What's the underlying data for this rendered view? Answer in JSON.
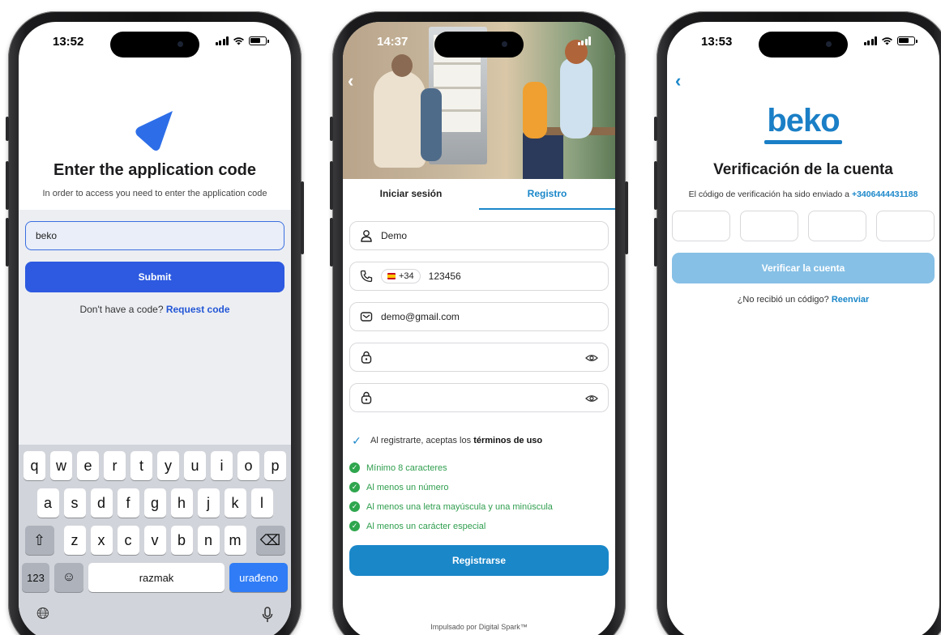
{
  "phone1": {
    "time": "13:52",
    "title": "Enter the application code",
    "subtitle": "In order to access you need to enter the application code",
    "input_value": "beko",
    "submit_label": "Submit",
    "footer_prefix": "Don't have a code?",
    "footer_link": "Request code",
    "keyboard": {
      "row1": [
        "q",
        "w",
        "e",
        "r",
        "t",
        "y",
        "u",
        "i",
        "o",
        "p"
      ],
      "row2": [
        "a",
        "s",
        "d",
        "f",
        "g",
        "h",
        "j",
        "k",
        "l"
      ],
      "row3": [
        "z",
        "x",
        "c",
        "v",
        "b",
        "n",
        "m"
      ],
      "num_key": "123",
      "space_label": "razmak",
      "return_label": "urađeno"
    }
  },
  "phone2": {
    "time": "14:37",
    "tabs": [
      "Iniciar sesión",
      "Registro"
    ],
    "active_tab": "Registro",
    "name_value": "Demo",
    "phone_prefix": "+34",
    "phone_value": "123456",
    "email_value": "demo@gmail.com",
    "terms_prefix": "Al registrarte, aceptas los",
    "terms_link": "términos de uso",
    "rules": [
      "Mínimo 8 caracteres",
      "Al menos un número",
      "Al menos una letra mayúscula y una minúscula",
      "Al menos un carácter especial"
    ],
    "register_label": "Registrarse",
    "powered_by": "Impulsado por Digital Spark™"
  },
  "phone3": {
    "time": "13:53",
    "logo_text": "beko",
    "title": "Verificación de la cuenta",
    "subtitle_prefix": "El código de verificación ha sido enviado a",
    "phone_number": "+3406444431188",
    "verify_label": "Verificar la cuenta",
    "footer_prefix": "¿No recibió un código?",
    "footer_link": "Reenviar"
  },
  "colors": {
    "app_blue": "#2d5ae0",
    "beko_blue": "#1a87c9",
    "success_green": "#2fa64e",
    "disabled_blue": "#86c0e6"
  }
}
